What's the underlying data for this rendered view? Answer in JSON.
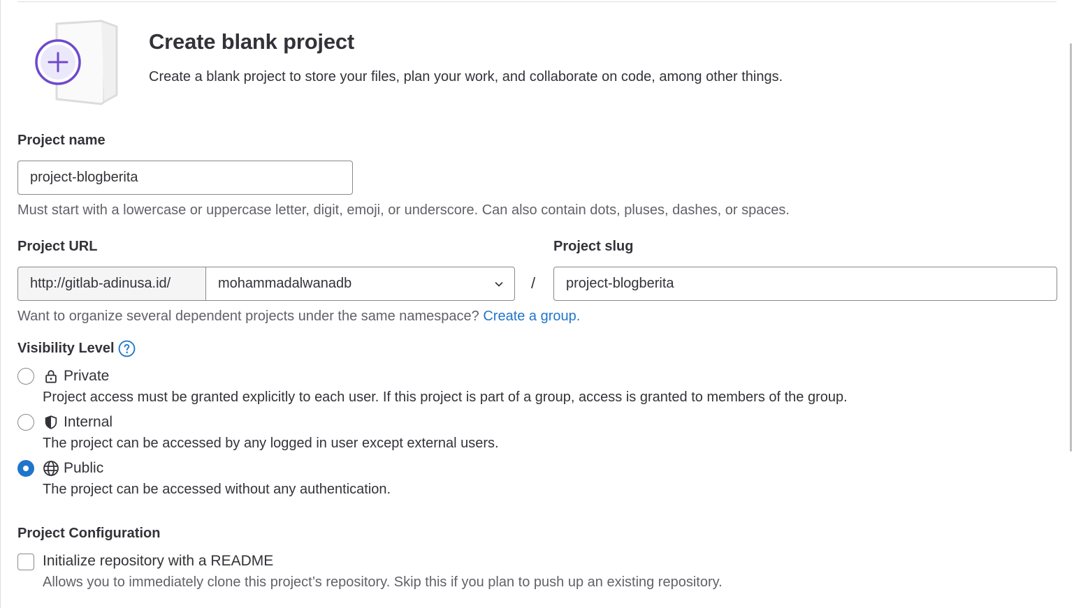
{
  "page": {
    "title": "Create blank project",
    "description": "Create a blank project to store your files, plan your work, and collaborate on code, among other things."
  },
  "project_name": {
    "label": "Project name",
    "value": "project-blogberita",
    "help": "Must start with a lowercase or uppercase letter, digit, emoji, or underscore. Can also contain dots, pluses, dashes, or spaces."
  },
  "project_url": {
    "label": "Project URL",
    "prefix": "http://gitlab-adinusa.id/",
    "namespace": "mohammadalwanadb",
    "separator": "/",
    "help_text": "Want to organize several dependent projects under the same namespace?",
    "help_link": "Create a group."
  },
  "project_slug": {
    "label": "Project slug",
    "value": "project-blogberita"
  },
  "visibility": {
    "label": "Visibility Level",
    "help_icon": "question-circle-icon",
    "selected": "Public",
    "options": [
      {
        "label": "Private",
        "icon": "lock-icon",
        "description": "Project access must be granted explicitly to each user. If this project is part of a group, access is granted to members of the group."
      },
      {
        "label": "Internal",
        "icon": "shield-icon",
        "description": "The project can be accessed by any logged in user except external users."
      },
      {
        "label": "Public",
        "icon": "globe-icon",
        "description": "The project can be accessed without any authentication."
      }
    ]
  },
  "configuration": {
    "label": "Project Configuration",
    "readme_label": "Initialize repository with a README",
    "readme_checked": false,
    "readme_help": "Allows you to immediately clone this project’s repository. Skip this if you plan to push up an existing repository."
  },
  "colors": {
    "accent": "#1f75cb",
    "illustration_purple": "#6e49cb",
    "text": "#333238",
    "muted": "#626168"
  }
}
